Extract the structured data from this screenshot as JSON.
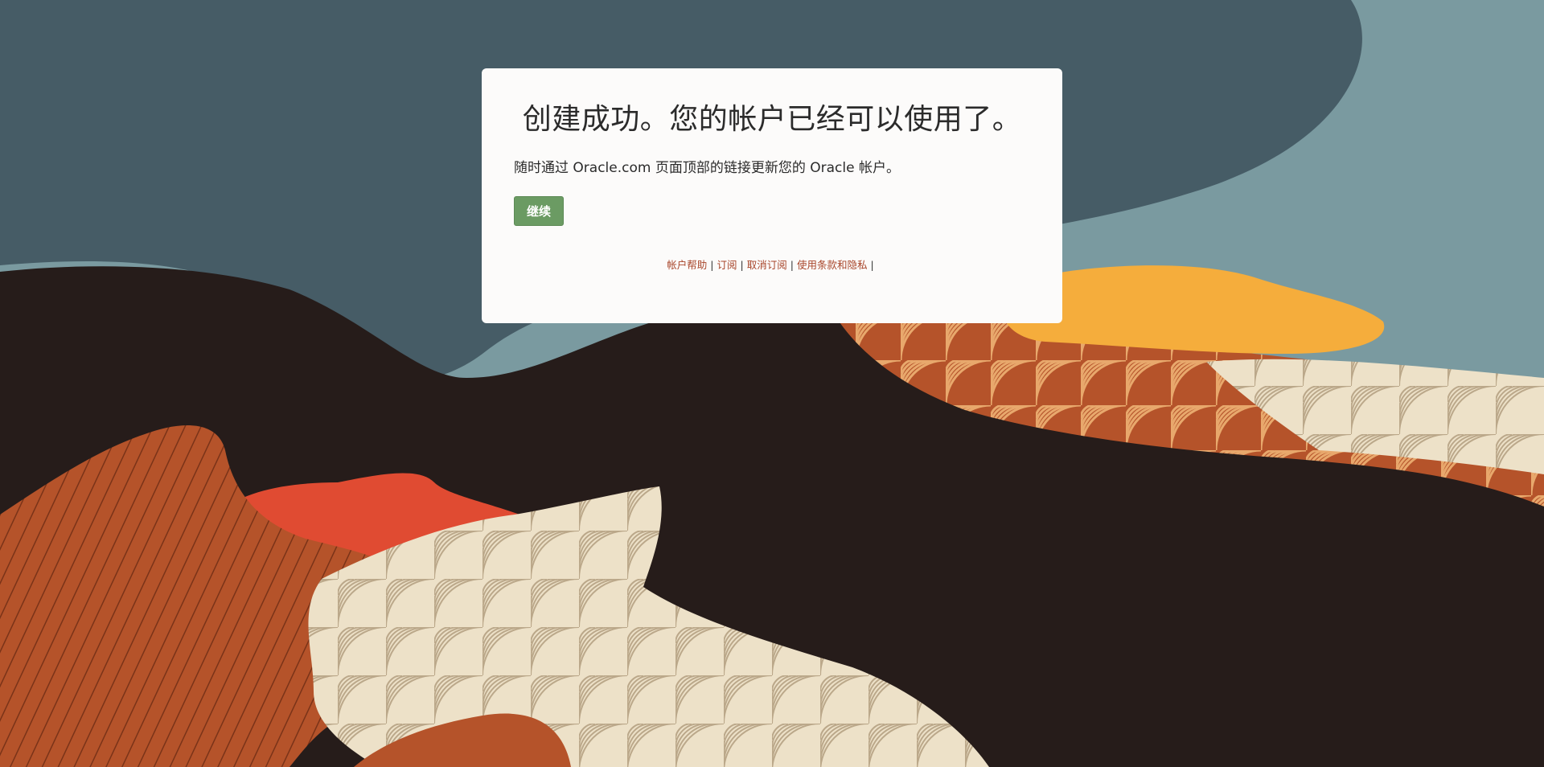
{
  "card": {
    "title": "创建成功。您的帐户已经可以使用了。",
    "description": "随时通过 Oracle.com 页面顶部的链接更新您的 Oracle 帐户。",
    "continue_label": "继续"
  },
  "footer": {
    "links": [
      {
        "label": "帐户帮助"
      },
      {
        "label": "订阅"
      },
      {
        "label": "取消订阅"
      },
      {
        "label": "使用条款和隐私"
      }
    ],
    "separator": "|"
  },
  "colors": {
    "card_bg": "#fcfbfa",
    "button_bg": "#6b9b63",
    "link": "#a8452a",
    "sky_dark": "#465c66",
    "sky_light": "#7a9aa0",
    "ground_dark": "#261c1a",
    "rust": "#b5532a",
    "cream": "#ede1c8",
    "yellow": "#f5ad3c",
    "red": "#e04b32"
  }
}
